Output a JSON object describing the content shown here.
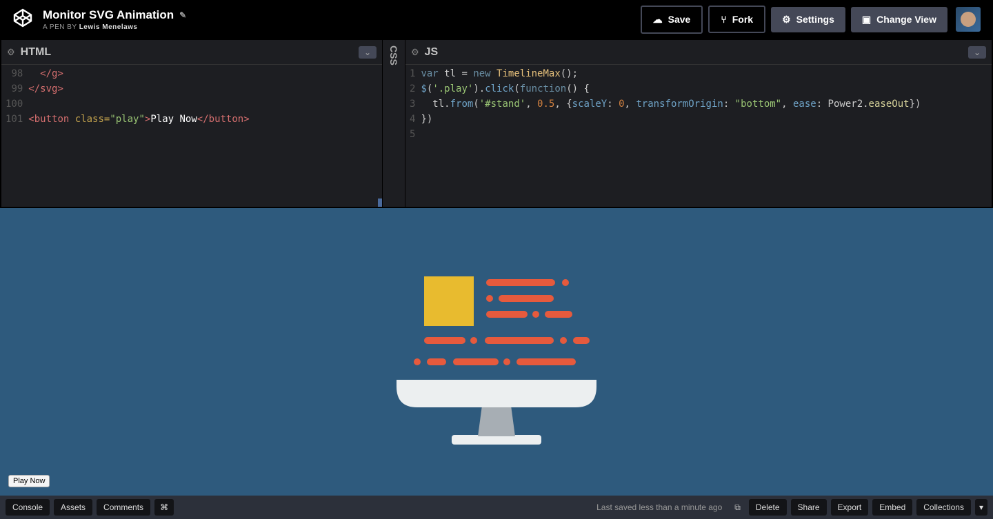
{
  "header": {
    "title": "Monitor SVG Animation",
    "byline_prefix": "A PEN BY",
    "author": "Lewis Menelaws",
    "buttons": {
      "save": "Save",
      "fork": "Fork",
      "settings": "Settings",
      "changeView": "Change View"
    }
  },
  "editors": {
    "html": {
      "title": "HTML",
      "gutter": [
        "98",
        "99",
        "100",
        "101"
      ],
      "lines": {
        "l98": "  </g>",
        "l99": "</svg>",
        "l100": "",
        "l101_open": "<button",
        "l101_attr": " class=",
        "l101_val": "\"play\"",
        "l101_gt": ">",
        "l101_text": "Play Now",
        "l101_close": "</button>"
      }
    },
    "css": {
      "title": "CSS"
    },
    "js": {
      "title": "JS",
      "gutter": [
        "1",
        "2",
        "3",
        "4",
        "5"
      ],
      "lines": {
        "l1_var": "var ",
        "l1_tl": "tl",
        "l1_eq": " = ",
        "l1_new": "new ",
        "l1_ctor": "TimelineMax",
        "l1_paren": "();",
        "l2_jq": "$",
        "l2_open": "(",
        "l2_sel": "'.play'",
        "l2_close": ").",
        "l2_click": "click",
        "l2_fnopen": "(",
        "l2_fn": "function",
        "l2_fnp": "() {",
        "l3_indent": "  tl.",
        "l3_from": "from",
        "l3_p1": "(",
        "l3_sel": "'#stand'",
        "l3_c1": ", ",
        "l3_dur": "0.5",
        "l3_c2": ", {",
        "l3_k1": "scaleY",
        "l3_c3": ": ",
        "l3_v1": "0",
        "l3_c4": ", ",
        "l3_k2": "transformOrigin",
        "l3_c5": ": ",
        "l3_v2": "\"bottom\"",
        "l3_c6": ", ",
        "l3_k3": "ease",
        "l3_c7": ": Power2.",
        "l3_v3": "easeOut",
        "l3_end": "})",
        "l4": "})",
        "l5": ""
      }
    }
  },
  "preview": {
    "play_label": "Play Now"
  },
  "footer": {
    "console": "Console",
    "assets": "Assets",
    "comments": "Comments",
    "shortcuts": "⌘",
    "lastSaved": "Last saved less than a minute ago",
    "delete": "Delete",
    "share": "Share",
    "export": "Export",
    "embed": "Embed",
    "collections": "Collections",
    "caret": "▾"
  }
}
